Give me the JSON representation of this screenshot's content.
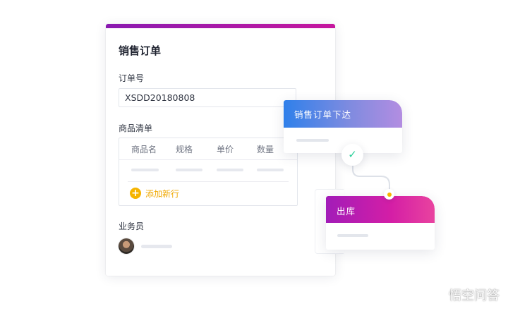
{
  "form": {
    "title": "销售订单",
    "order_no_label": "订单号",
    "order_no_value": "XSDD20180808",
    "goods_label": "商品清单",
    "columns": [
      "商品名",
      "规格",
      "单价",
      "数量"
    ],
    "add_row_label": "添加新行",
    "salesperson_label": "业务员"
  },
  "flow": {
    "step1_label": "销售订单下达",
    "step2_label": "出库"
  },
  "watermark": {
    "text": "悟空问答"
  },
  "colors": {
    "form_accent": "#a61ab0",
    "step1_gradient": [
      "#2f80ea",
      "#b38de1"
    ],
    "step2_gradient": [
      "#a21cb8",
      "#e9439f"
    ],
    "check": "#2bcf9a",
    "add_row": "#f5b400"
  }
}
